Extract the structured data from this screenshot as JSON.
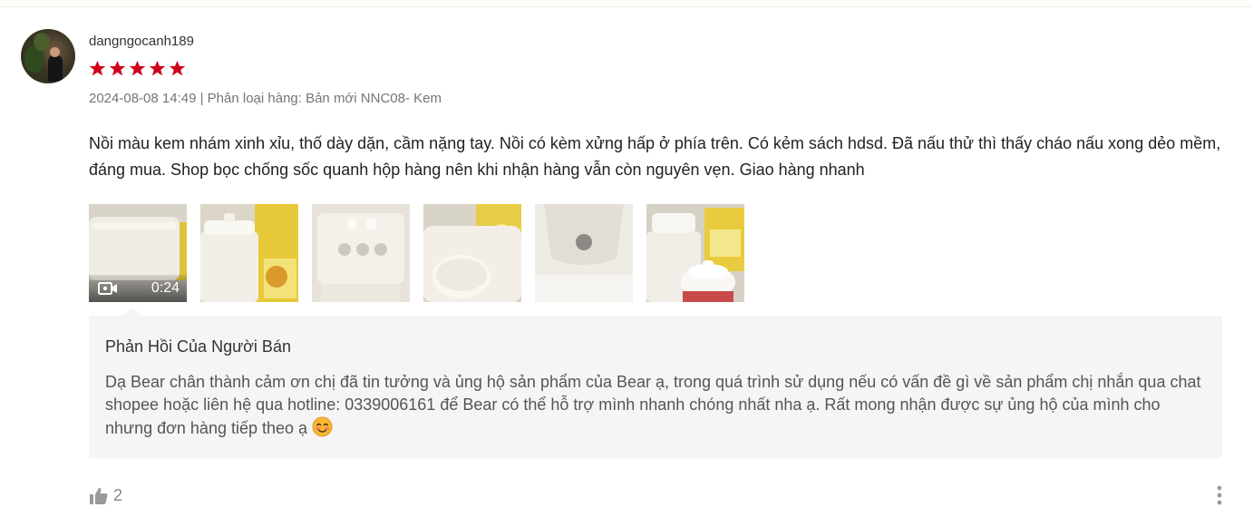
{
  "review": {
    "username": "dangngocanh189",
    "rating": 5,
    "rating_color": "#d0011b",
    "meta": "2024-08-08 14:49 | Phân loại hàng: Bản mới NNC08- Kem",
    "content": "Nồi màu kem nhám xinh xỉu, thố dày dặn, cầm nặng tay. Nồi có kèm xửng hấp ở phía trên. Có kẻm sách hdsd. Đã nấu thử thì thấy cháo nấu xong dẻo mềm, đáng mua. Shop bọc chống sốc quanh hộp hàng nên khi nhận hàng vẫn còn nguyên vẹn. Giao hàng nhanh",
    "media": {
      "video_duration": "0:24",
      "image_count": 5
    }
  },
  "seller_reply": {
    "title": "Phản Hồi Của Người Bán",
    "text": "Dạ Bear chân thành cảm ơn chị đã tin tưởng và ủng hộ sản phẩm của Bear ạ, trong quá trình sử dụng nếu có vấn đề gì về sản phẩm chị nhắn qua chat shopee hoặc liên hệ qua hotline: 0339006161 để Bear có thể hỗ trợ mình nhanh chóng nhất nha ạ. Rất mong nhận được sự ủng hộ của mình cho nhưng đơn hàng tiếp theo ạ"
  },
  "actions": {
    "like_count": "2"
  }
}
